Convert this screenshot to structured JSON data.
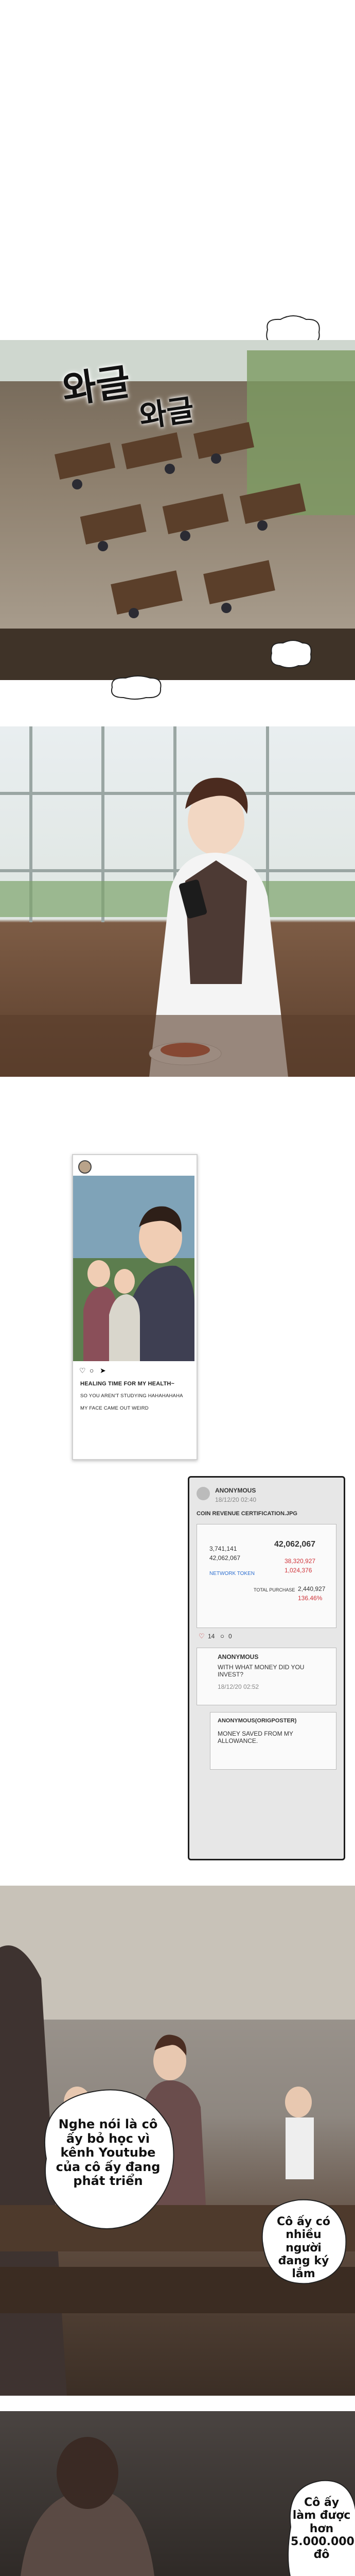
{
  "panel1": {
    "sfx_large": "와글",
    "sfx_small": "와글"
  },
  "post": {
    "caption": "HEALING TIME FOR MY HEALTH~",
    "comment_1": "SO YOU AREN'T STUDYING HAHAHAHAHA",
    "comment_2": "MY FACE CAME OUT WEIRD"
  },
  "phone": {
    "user_1": "ANONYMOUS",
    "time_1": "18/12/20 02:40",
    "file_1": "COIN REVENUE CERTIFICATION.JPG",
    "val_a": "3,741,141",
    "val_b": "42,062,067",
    "val_c": "42,062,067",
    "val_d": "38,320,927",
    "val_e": "1,024,376",
    "token": "NETWORK TOKEN",
    "label_total": "TOTAL PURCHASE",
    "val_f": "2,440,927",
    "val_g": "136.46%",
    "likes": "14",
    "comments": "0",
    "user_2": "ANONYMOUS",
    "question": "WITH WHAT MONEY DID YOU INVEST?",
    "time_2": "18/12/20 02:52",
    "user_3": "ANONYMOUS(ORIGPOSTER)",
    "reply": "MONEY SAVED FROM MY ALLOWANCE."
  },
  "panel5": {
    "bubble_left": "Nghe nói là cô ấy bỏ học vì kênh Youtube của cô ấy đang phát triển",
    "bubble_right": "Cô ấy có nhiều người đang ký lắm"
  },
  "panel6": {
    "bubble_bottom": "Cô ấy làm được hơn 5.000.000 đô"
  },
  "colors": {
    "accent_red": "#d0343a",
    "link_blue": "#2d6fd0"
  }
}
